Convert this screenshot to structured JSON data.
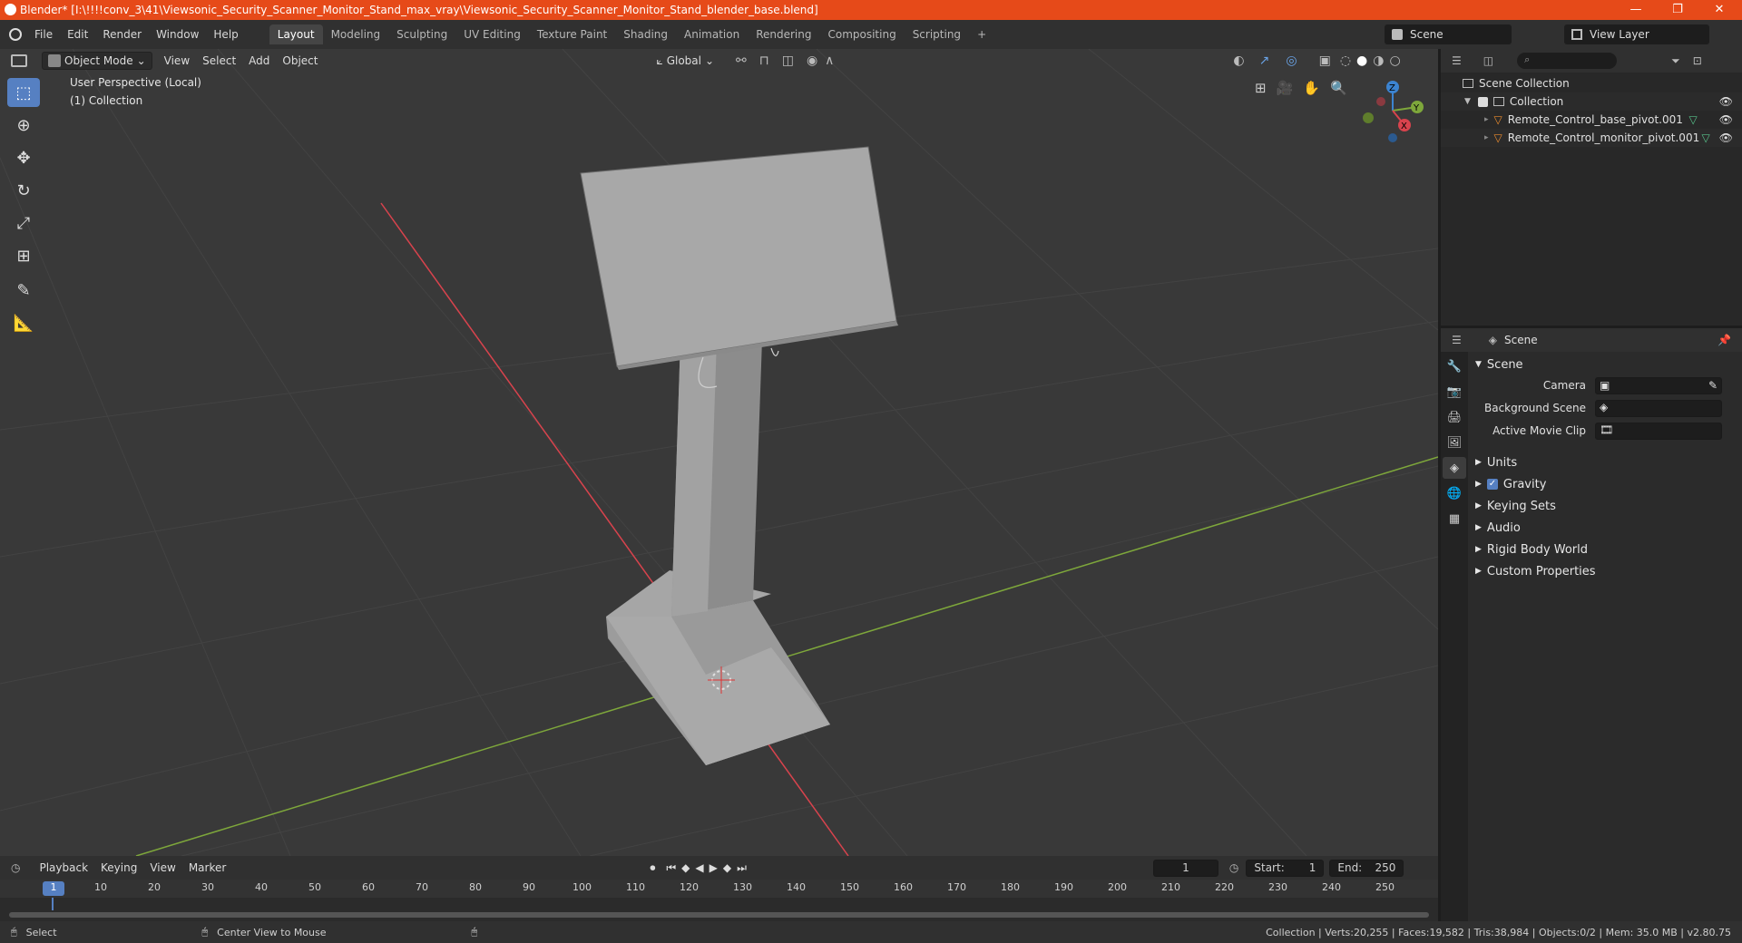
{
  "window": {
    "title": "Blender* [I:\\!!!!conv_3\\41\\Viewsonic_Security_Scanner_Monitor_Stand_max_vray\\Viewsonic_Security_Scanner_Monitor_Stand_blender_base.blend]",
    "minimize": "—",
    "maximize": "❐",
    "close": "✕"
  },
  "menu": {
    "items": [
      "File",
      "Edit",
      "Render",
      "Window",
      "Help"
    ],
    "workspaces": [
      "Layout",
      "Modeling",
      "Sculpting",
      "UV Editing",
      "Texture Paint",
      "Shading",
      "Animation",
      "Rendering",
      "Compositing",
      "Scripting"
    ],
    "active_workspace": "Layout",
    "add_tab": "+",
    "scene_label": "Scene",
    "view_layer_label": "View Layer"
  },
  "viewport_header": {
    "mode": "Object Mode",
    "view": "View",
    "select": "Select",
    "add": "Add",
    "object": "Object",
    "transform_orientation": "Global"
  },
  "viewport": {
    "perspective_label": "User Perspective (Local)",
    "collection_label": "(1) Collection",
    "gizmo": {
      "x": "X",
      "y": "Y",
      "z": "Z"
    }
  },
  "outliner": {
    "scene_collection": "Scene Collection",
    "collection": "Collection",
    "objects": [
      "Remote_Control_base_pivot.001",
      "Remote_Control_monitor_pivot.001"
    ]
  },
  "properties": {
    "context": "Scene",
    "panel": "Scene",
    "camera_label": "Camera",
    "background_scene_label": "Background Scene",
    "active_movie_clip_label": "Active Movie Clip",
    "sections": [
      "Units",
      "Gravity",
      "Keying Sets",
      "Audio",
      "Rigid Body World",
      "Custom Properties"
    ],
    "gravity_checked": true
  },
  "timeline": {
    "playback": "Playback",
    "keying": "Keying",
    "view": "View",
    "marker": "Marker",
    "current_frame": "1",
    "start_label": "Start:",
    "start": "1",
    "end_label": "End:",
    "end": "250",
    "ticks": [
      "1",
      "10",
      "20",
      "30",
      "40",
      "50",
      "60",
      "70",
      "80",
      "90",
      "100",
      "110",
      "120",
      "130",
      "140",
      "150",
      "160",
      "170",
      "180",
      "190",
      "200",
      "210",
      "220",
      "230",
      "240",
      "250"
    ]
  },
  "status": {
    "select": "Select",
    "center_view": "Center View to Mouse",
    "stats": "Collection | Verts:20,255 | Faces:19,582 | Tris:38,984 | Objects:0/2 | Mem: 35.0 MB | v2.80.75"
  },
  "colors": {
    "accent": "#5680c2",
    "titlebar": "#e64a19",
    "x_axis": "#d8434d",
    "y_axis": "#7ea73b",
    "z_axis": "#3c84d1"
  }
}
